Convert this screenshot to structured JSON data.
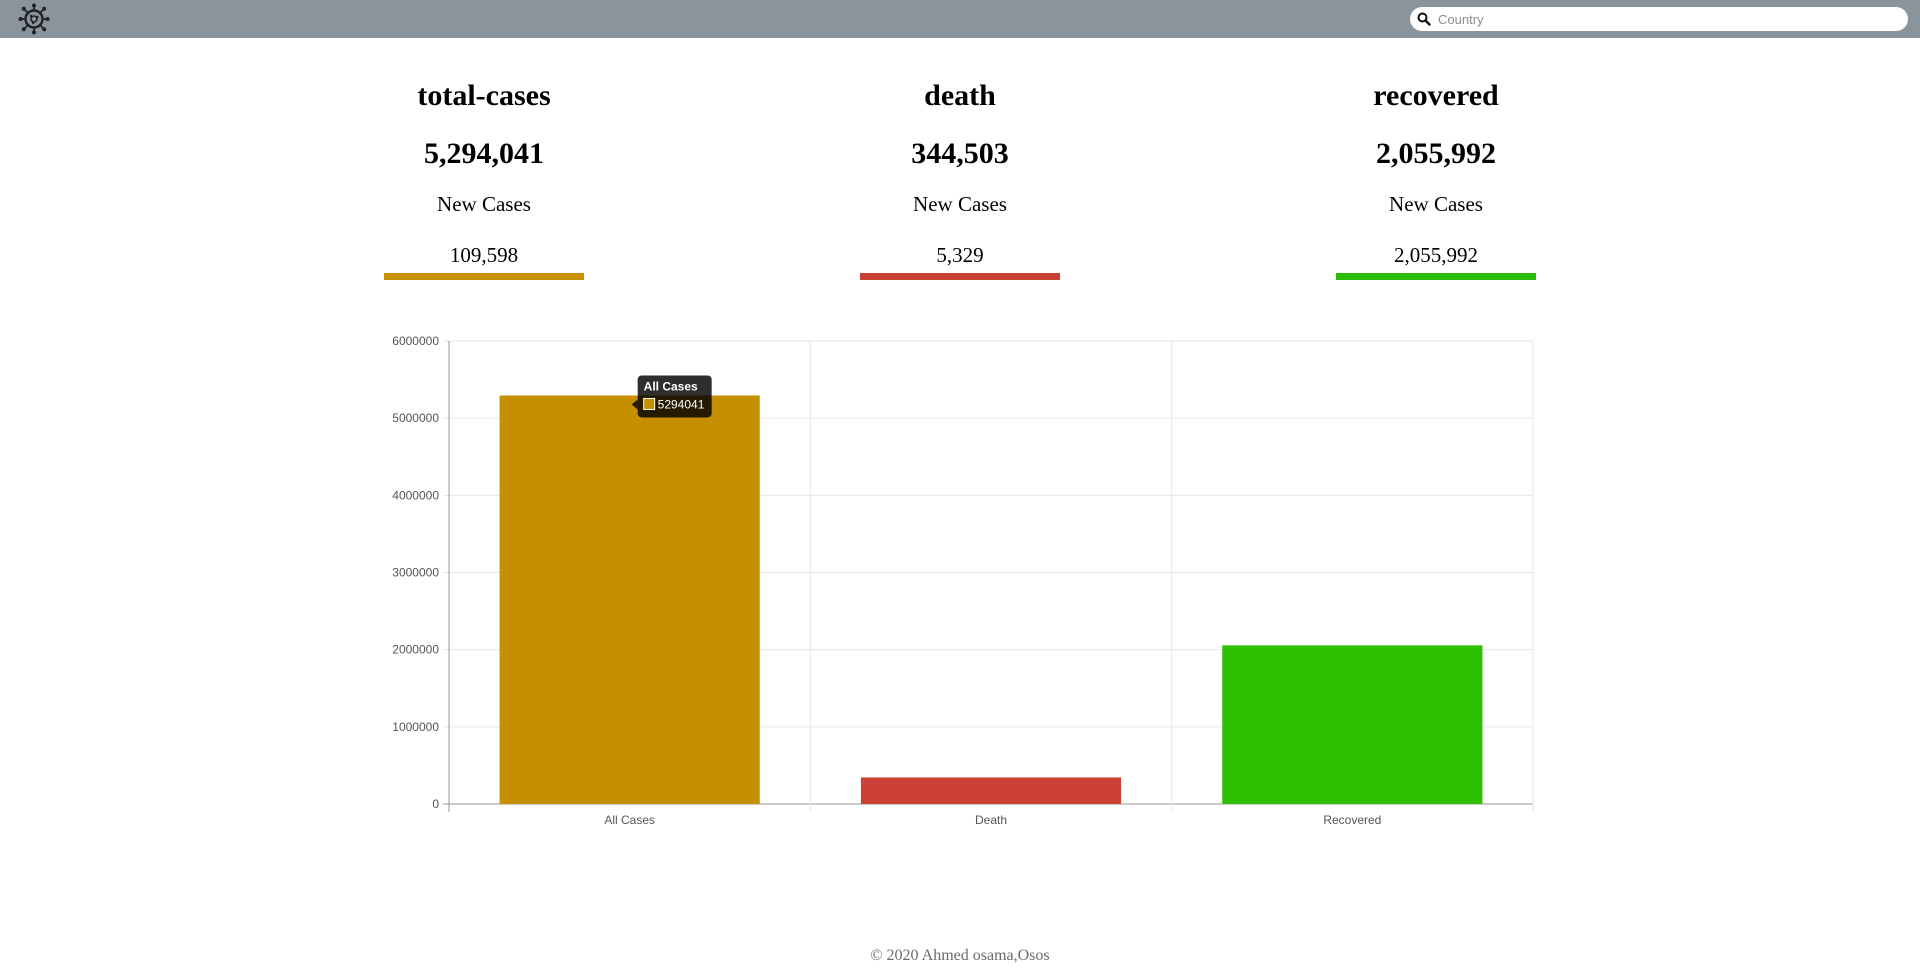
{
  "header": {
    "logo_icon": "virus-icon",
    "search_placeholder": "Country",
    "search_value": "",
    "search_icon": "search-icon"
  },
  "stats": [
    {
      "id": "total",
      "title": "total-cases",
      "value": "5,294,041",
      "new_label": "New Cases",
      "new_value": "109,598",
      "color": "#c89200"
    },
    {
      "id": "death",
      "title": "death",
      "value": "344,503",
      "new_label": "New Cases",
      "new_value": "5,329",
      "color": "#cc4136"
    },
    {
      "id": "recovered",
      "title": "recovered",
      "value": "2,055,992",
      "new_label": "New Cases",
      "new_value": "2,055,992",
      "color": "#2cbd00"
    }
  ],
  "chart_data": {
    "type": "bar",
    "categories": [
      "All Cases",
      "Death",
      "Recovered"
    ],
    "values": [
      5294041,
      344503,
      2055992
    ],
    "colors": [
      "#c68f00",
      "#cc4136",
      "#2ebf03"
    ],
    "ylim": [
      0,
      6000000
    ],
    "yticks": [
      "0",
      "1000000",
      "2000000",
      "3000000",
      "4000000",
      "5000000",
      "6000000"
    ],
    "grid": true,
    "tooltip": {
      "category": "All Cases",
      "value": "5294041"
    }
  },
  "footer": {
    "text": "© 2020 Ahmed osama,Osos"
  }
}
